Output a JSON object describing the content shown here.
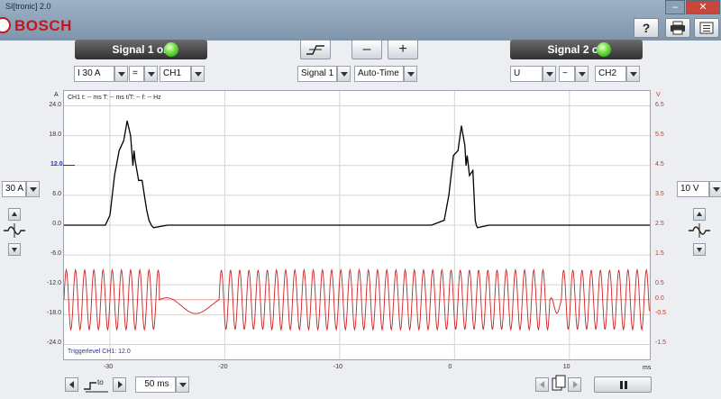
{
  "window": {
    "title": "SI[tronic] 2.0",
    "minimize": "–",
    "close": "✕"
  },
  "brand": {
    "name": "BOSCH"
  },
  "toolbar": {
    "help_label": "?",
    "print_icon": "printer-icon",
    "menu_icon": "list-icon"
  },
  "signal1": {
    "label": "Signal 1 on",
    "led_color": "#52d62a",
    "measurand": "I 30 A",
    "coupling": "=",
    "channel": "CH1",
    "range": "30 A"
  },
  "signal2": {
    "label": "Signal 2 on",
    "led_color": "#52d62a",
    "measurand": "U",
    "coupling": "~",
    "channel": "CH2",
    "range": "10 V"
  },
  "trigger": {
    "edge_icon": "trigger-edge-icon",
    "minus_label": "–",
    "plus_label": "+",
    "source": "Signal 1",
    "mode": "Auto-Time"
  },
  "plot": {
    "readout": "CH1  t: -- ms   T: -- ms   t/T: --   f: -- Hz",
    "left_unit": "A",
    "right_unit": "V",
    "trigger_level_marker": "12.0",
    "trigger_text": "Triggerlevel CH1: 12.0",
    "x_unit": "ms",
    "colors": {
      "ch1": "#000000",
      "ch2": "#cc2222",
      "grid": "#d4d4d4"
    }
  },
  "chart_data": {
    "type": "line",
    "xlim": [
      -34,
      17
    ],
    "x_ticks": [
      "-30",
      "-20",
      "-10",
      "0",
      "10"
    ],
    "y_left_ticks": [
      "24.0",
      "18.0",
      "12.0",
      "6.0",
      "0.0",
      "-6.0",
      "-12.0",
      "-18.0",
      "-24.0"
    ],
    "y_left_range": [
      -27,
      27
    ],
    "y_right_ticks": [
      "6.5",
      "5.5",
      "4.5",
      "3.5",
      "2.5",
      "1.5",
      "0.5",
      "0.0",
      "-0.5",
      "-1.5"
    ],
    "y_right_range": [
      -2,
      7
    ],
    "grid": true,
    "series": [
      {
        "channel": "CH1",
        "axis": "left",
        "color": "#000000",
        "x": [
          -34,
          -30.4,
          -30.0,
          -29.6,
          -29.2,
          -28.8,
          -28.5,
          -28.2,
          -28.0,
          -27.9,
          -27.8,
          -27.5,
          -27.2,
          -27.0,
          -26.8,
          -26.6,
          -26.4,
          -26.2,
          -25.0,
          -21.0,
          -15.0,
          -8.0,
          -2.0,
          -0.9,
          -0.5,
          -0.1,
          0.3,
          0.6,
          0.9,
          1.0,
          1.1,
          1.3,
          1.6,
          1.7,
          1.8,
          1.9,
          2.0,
          3.0,
          8.0,
          12.0,
          17.0
        ],
        "y": [
          0,
          0,
          2,
          10,
          15,
          17,
          21,
          18,
          12,
          15,
          13,
          9,
          9,
          6,
          3,
          1,
          0,
          -0.5,
          0,
          0,
          0,
          0,
          0,
          1,
          6,
          14,
          15,
          20,
          16,
          12,
          14,
          10,
          11,
          6,
          1,
          0,
          -0.5,
          0,
          0,
          0,
          0
        ]
      },
      {
        "channel": "CH2",
        "axis": "right",
        "color": "#cc2222",
        "bursts": [
          [
            -34,
            -25.7,
            0.8
          ],
          [
            -20.5,
            8.3,
            0.8
          ],
          [
            9.3,
            17,
            0.8
          ]
        ],
        "gaps": [
          [
            -25.7,
            -20.5
          ],
          [
            8.3,
            9.3
          ]
        ],
        "amplitude_v": 1.0,
        "offset_v": 0.0
      }
    ]
  },
  "bottom": {
    "timebase": "50 ms",
    "trigger_pos_icon": "trigger-position-icon",
    "page_icon": "page-icon",
    "pause_icon": "pause-icon"
  }
}
